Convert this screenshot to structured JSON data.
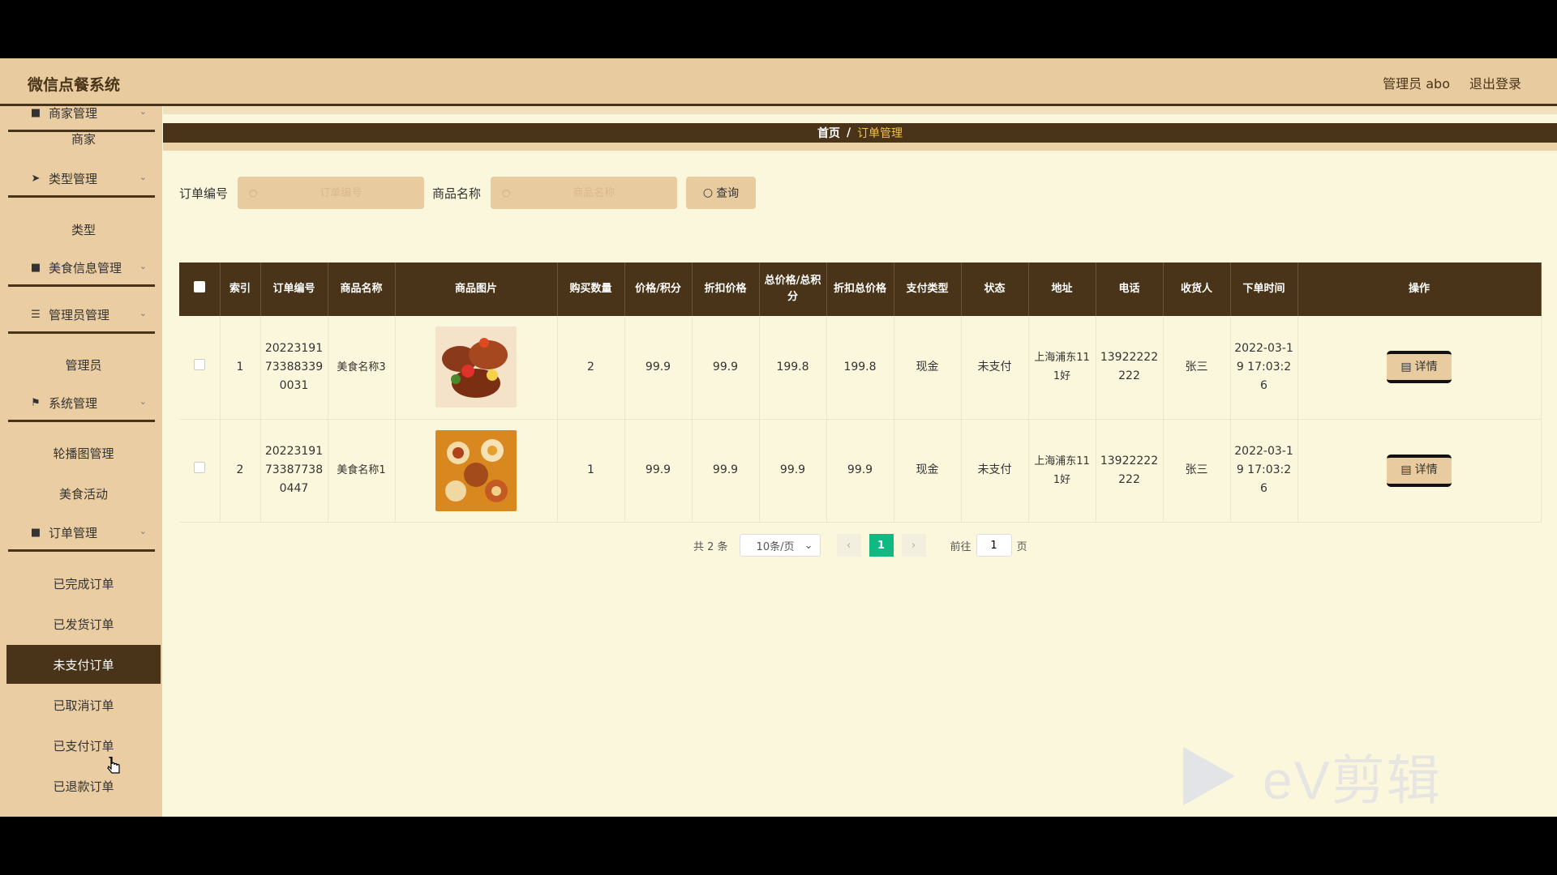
{
  "app": {
    "title": "微信点餐系统"
  },
  "header": {
    "user": "管理员 abo",
    "logout": "退出登录"
  },
  "sidebar": {
    "groups": [
      {
        "label": "商家管理",
        "icon": "grid-icon"
      },
      {
        "label": "类型管理",
        "icon": "send-icon"
      },
      {
        "label": "美食信息管理",
        "icon": "grid-icon"
      },
      {
        "label": "管理员管理",
        "icon": "sliders-icon"
      },
      {
        "label": "系统管理",
        "icon": "flag-icon"
      },
      {
        "label": "订单管理",
        "icon": "grid-icon"
      }
    ],
    "items": [
      "商家",
      "类型",
      "管理员",
      "轮播图管理",
      "美食活动",
      "已完成订单",
      "已发货订单",
      "未支付订单",
      "已取消订单",
      "已支付订单",
      "已退款订单"
    ],
    "active": "未支付订单"
  },
  "breadcrumb": {
    "home": "首页",
    "sep": "/",
    "current": "订单管理"
  },
  "search": {
    "order_no_label": "订单编号",
    "order_no_placeholder": "订单编号",
    "goods_name_label": "商品名称",
    "goods_name_placeholder": "商品名称",
    "query_label": "查询"
  },
  "table": {
    "headers": [
      "索引",
      "订单编号",
      "商品名称",
      "商品图片",
      "购买数量",
      "价格/积分",
      "折扣价格",
      "总价格/总积分",
      "折扣总价格",
      "支付类型",
      "状态",
      "地址",
      "电话",
      "收货人",
      "下单时间",
      "操作"
    ],
    "rows": [
      {
        "index": "1",
        "order_no": "20223191733883390031",
        "goods": "美食名称3",
        "qty": "2",
        "price": "99.9",
        "discount": "99.9",
        "total": "199.8",
        "discount_total": "199.8",
        "pay_type": "现金",
        "status": "未支付",
        "address": "上海浦东111好",
        "phone": "13922222222",
        "receiver": "张三",
        "time": "2022-03-19 17:03:26",
        "action": "详情"
      },
      {
        "index": "2",
        "order_no": "20223191733877380447",
        "goods": "美食名称1",
        "qty": "1",
        "price": "99.9",
        "discount": "99.9",
        "total": "99.9",
        "discount_total": "99.9",
        "pay_type": "现金",
        "status": "未支付",
        "address": "上海浦东111好",
        "phone": "13922222222",
        "receiver": "张三",
        "time": "2022-03-19 17:03:26",
        "action": "详情"
      }
    ]
  },
  "pagination": {
    "total": "共 2 条",
    "page_size": "10条/页",
    "current": "1",
    "goto_label": "前往",
    "goto_value": "1",
    "page_suffix": "页"
  },
  "watermark": {
    "text": "eV剪辑"
  },
  "colors": {
    "brown": "#4a3419",
    "tan": "#e8cca0",
    "cream": "#fbf7dc",
    "green": "#10b981"
  }
}
